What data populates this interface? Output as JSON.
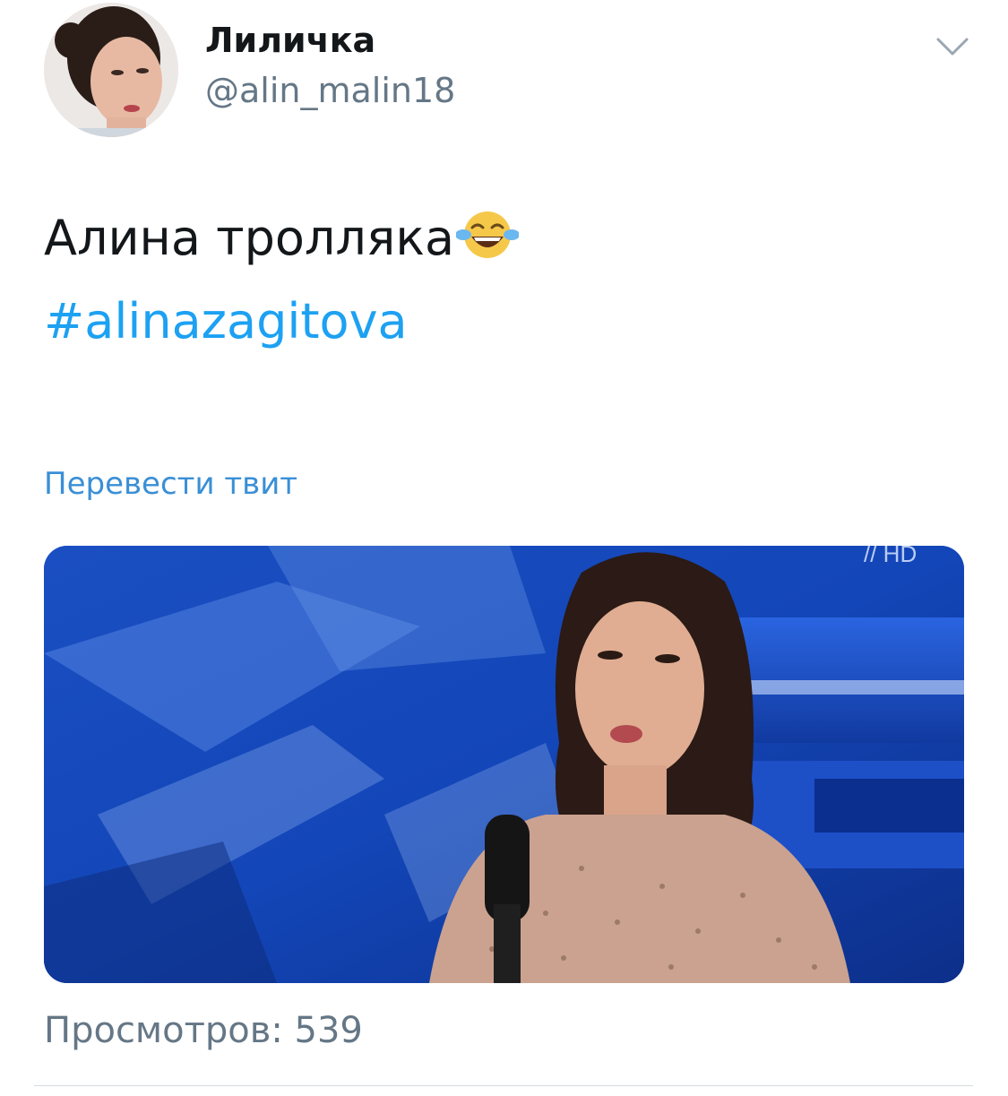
{
  "author": {
    "display_name": "Лиличка",
    "handle": "@alin_malin18",
    "avatar_icon": "profile-photo"
  },
  "menu": {
    "icon": "chevron-down-icon"
  },
  "tweet": {
    "text": "Алина тролляка",
    "emoji": "😂",
    "hashtag": "#alinazagitova",
    "translate_label": "Перевести твит"
  },
  "media": {
    "type": "video",
    "description_icon": "video-thumbnail",
    "channel_logo": "1 HD"
  },
  "stats": {
    "views_label": "Просмотров: 539"
  },
  "colors": {
    "link": "#1da1f2",
    "translate": "#3a8fd6",
    "secondary_text": "#657786",
    "primary_text": "#14171a",
    "divider": "#d6dbe0"
  }
}
